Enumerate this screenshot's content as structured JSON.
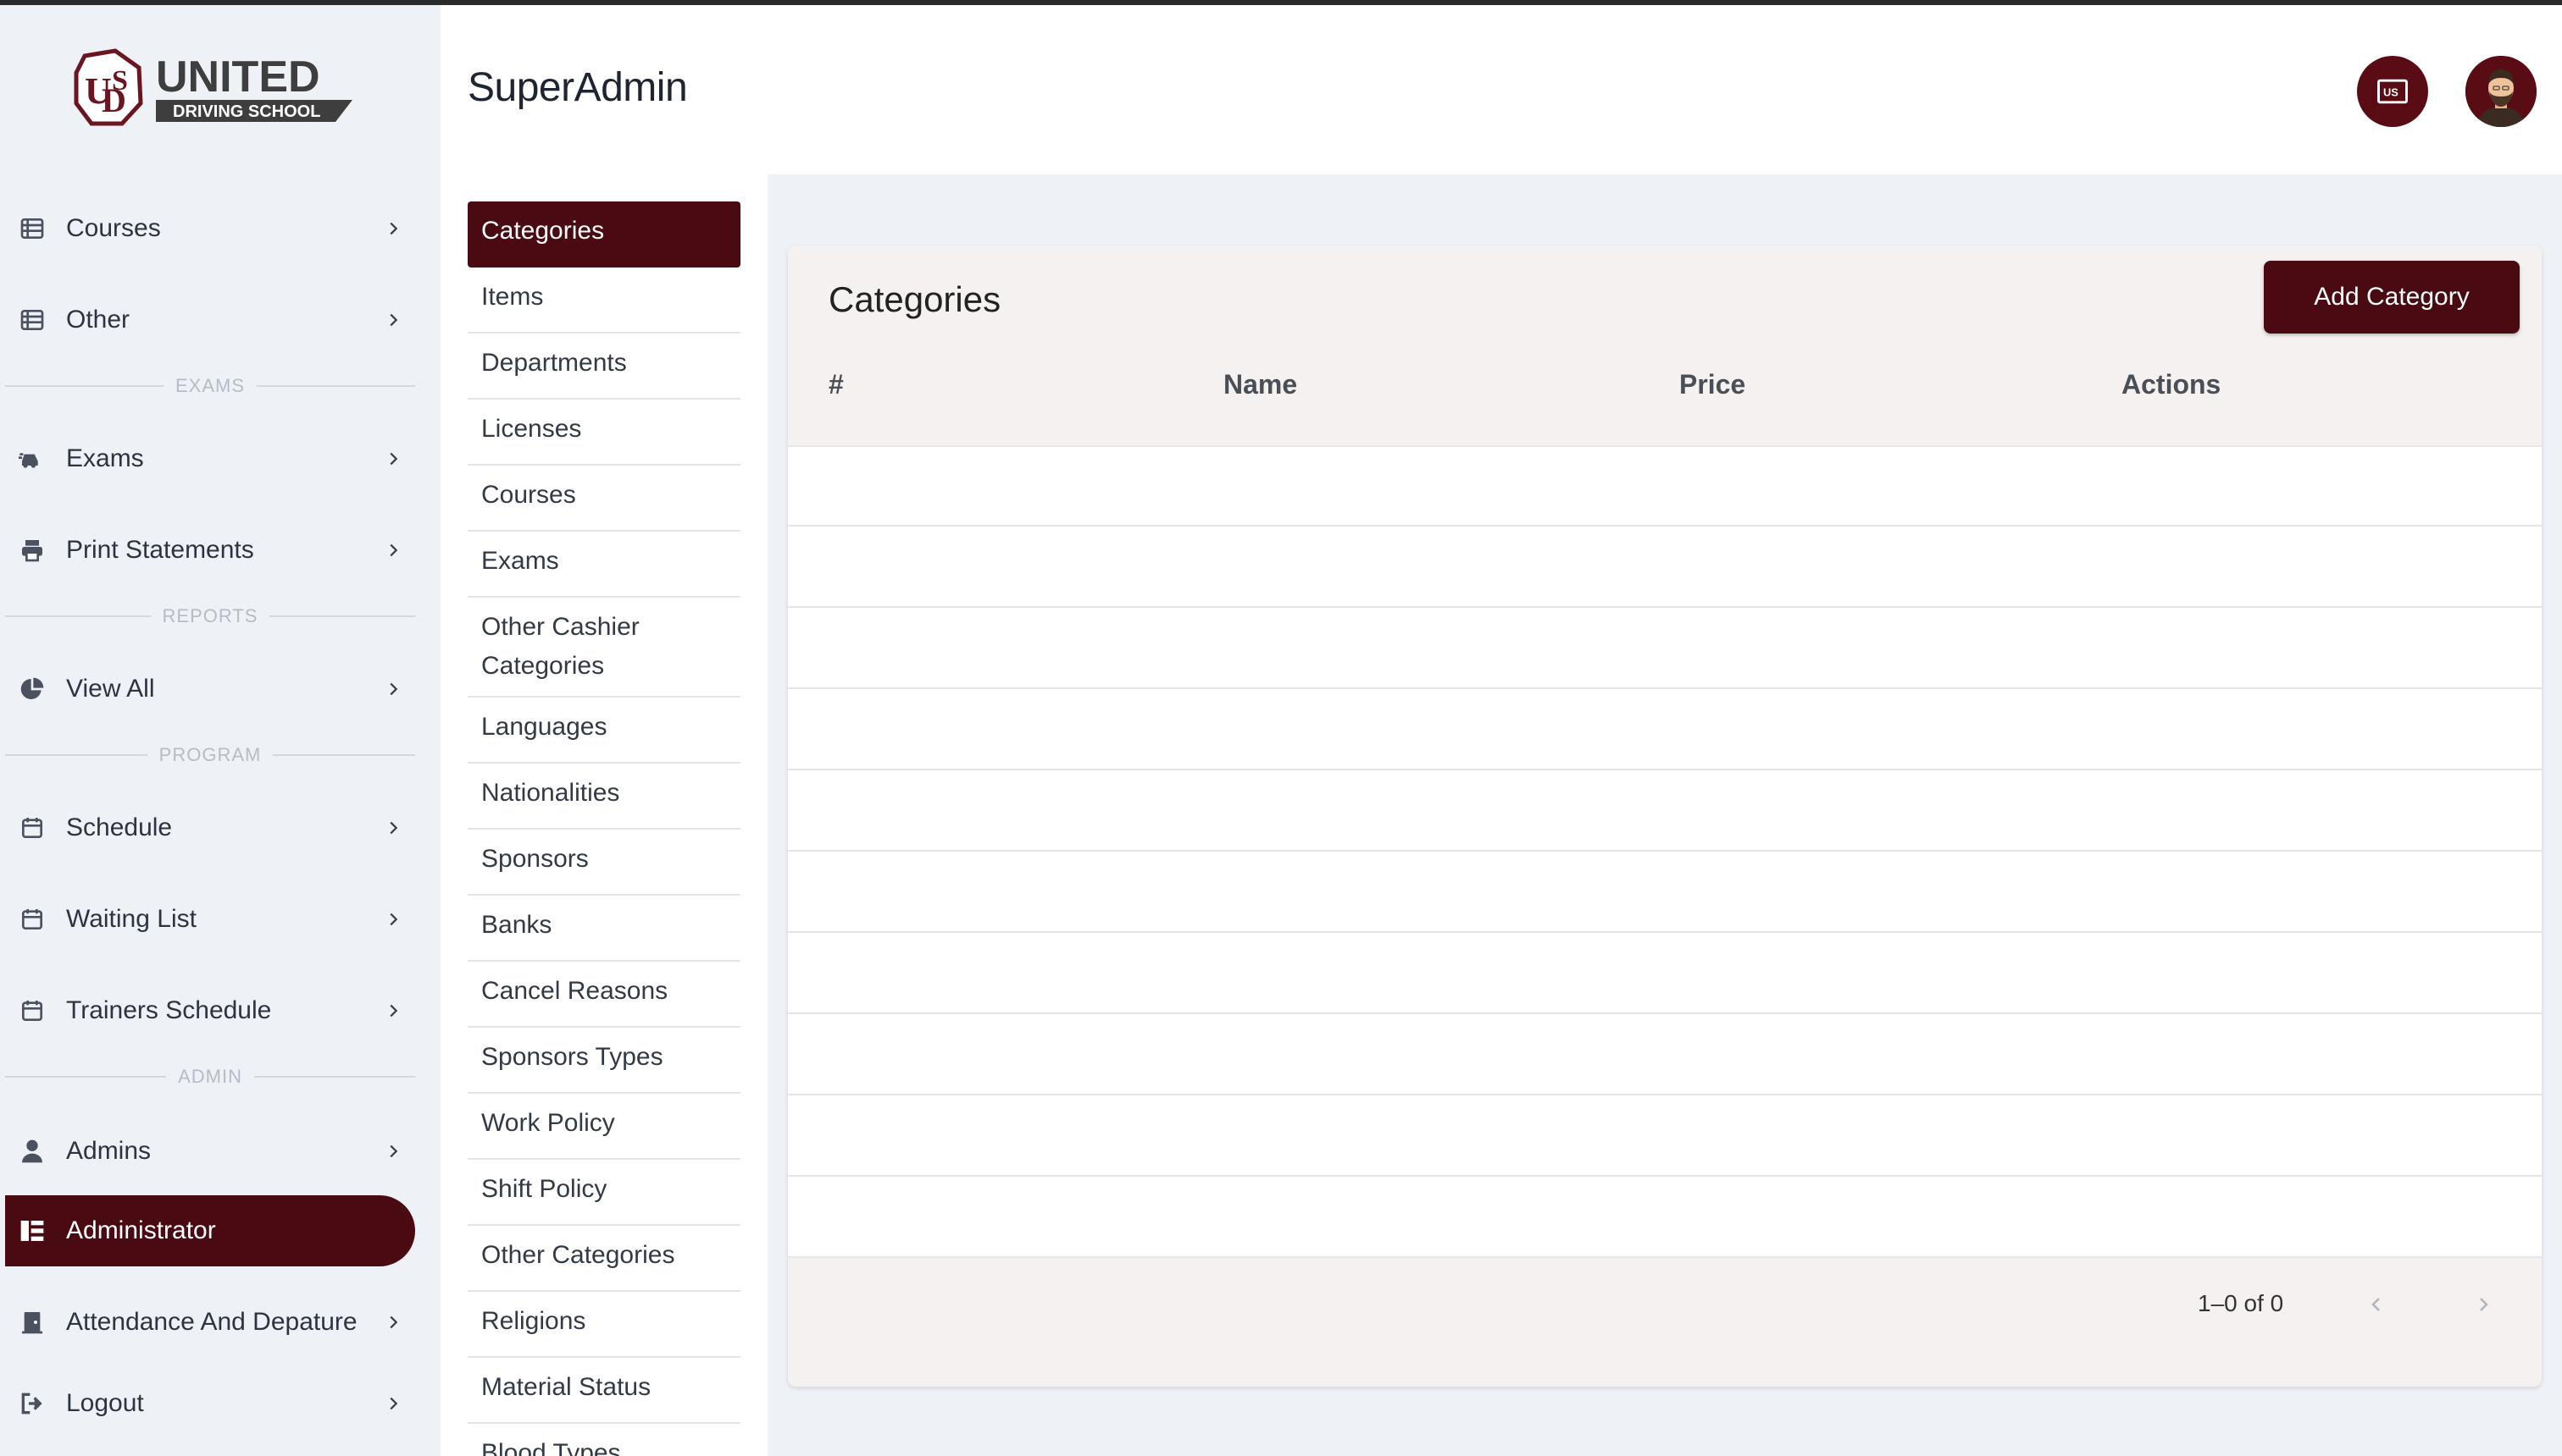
{
  "brand": {
    "logo_text_main": "UNITED",
    "logo_text_sub": "DRIVING SCHOOL",
    "accent_color": "#4a0a12"
  },
  "header": {
    "title": "SuperAdmin",
    "language_icon": "language-flag-icon",
    "avatar_icon": "user-avatar-icon"
  },
  "sidebar": {
    "items": [
      {
        "label": "Courses",
        "icon": "table-icon"
      },
      {
        "label": "Other",
        "icon": "table-icon"
      },
      {
        "label": "Exams",
        "icon": "car-icon"
      },
      {
        "label": "Print Statements",
        "icon": "printer-icon"
      },
      {
        "label": "View All",
        "icon": "pie-chart-icon"
      },
      {
        "label": "Schedule",
        "icon": "calendar-icon"
      },
      {
        "label": "Waiting List",
        "icon": "calendar-icon"
      },
      {
        "label": "Trainers Schedule",
        "icon": "calendar-icon"
      },
      {
        "label": "Admins",
        "icon": "user-icon"
      },
      {
        "label": "Administrator",
        "icon": "sitemap-icon",
        "active": true
      },
      {
        "label": "Attendance And Depature",
        "icon": "door-icon"
      },
      {
        "label": "Logout",
        "icon": "logout-icon"
      }
    ],
    "sections": {
      "exams": "EXAMS",
      "reports": "REPORTS",
      "program": "PROGRAM",
      "admin": "ADMIN"
    }
  },
  "submenu": {
    "items": [
      "Categories",
      "Items",
      "Departments",
      "Licenses",
      "Courses",
      "Exams",
      "Other Cashier Categories",
      "Languages",
      "Nationalities",
      "Sponsors",
      "Banks",
      "Cancel Reasons",
      "Sponsors Types",
      "Work Policy",
      "Shift Policy",
      "Other Categories",
      "Religions",
      "Material Status",
      "Blood Types"
    ],
    "active_index": 0
  },
  "main": {
    "card_title": "Categories",
    "add_button_label": "Add Category",
    "columns": [
      "#",
      "Name",
      "Price",
      "Actions"
    ],
    "rows": [],
    "pagination": {
      "range_text": "1–0 of 0"
    }
  }
}
